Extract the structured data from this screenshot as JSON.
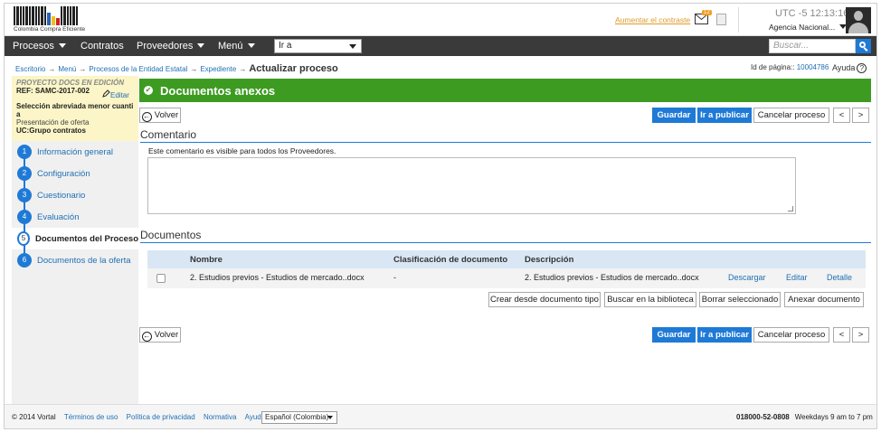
{
  "header": {
    "logo_text": "Colombia Compra Eficiente",
    "contrast_link": "Aumentar el contraste",
    "mail_badge": "12",
    "clock": "UTC -5 12:13:16",
    "agency": "Agencia Nacional..."
  },
  "nav": {
    "items": [
      "Procesos",
      "Contratos",
      "Proveedores",
      "Menú"
    ],
    "goto_value": "Ir a",
    "search_placeholder": "Buscar..."
  },
  "breadcrumb": {
    "items": [
      "Escritorio",
      "Menú",
      "Procesos de la Entidad Estatal",
      "Expediente"
    ],
    "current": "Actualizar proceso",
    "page_id_label": "Id de página::",
    "page_id": "10004786",
    "help": "Ayuda",
    "help_icon": "?"
  },
  "sidebar": {
    "status": "PROYECTO DOCS EN EDICIÓN",
    "ref": "REF: SAMC-2017-002",
    "edit": "Editar",
    "type_line1": "Selección abreviada menor cuanti",
    "type_line2": "a",
    "phase": "Presentación de oferta",
    "uc": "UC:Grupo contratos",
    "steps": [
      {
        "num": "1",
        "label": "Información general"
      },
      {
        "num": "2",
        "label": "Configuración"
      },
      {
        "num": "3",
        "label": "Cuestionario"
      },
      {
        "num": "4",
        "label": "Evaluación"
      },
      {
        "num": "5",
        "label": "Documentos del Proceso"
      },
      {
        "num": "6",
        "label": "Documentos de la oferta"
      }
    ]
  },
  "main": {
    "title": "Documentos anexos",
    "back": "Volver",
    "save": "Guardar",
    "publish": "Ir a publicar",
    "cancel": "Cancelar proceso",
    "prev": "<",
    "next": ">",
    "comment_section": "Comentario",
    "comment_note": "Este comentario es visible para todos los Proveedores.",
    "comment_value": "",
    "docs_section": "Documentos",
    "columns": [
      "Nombre",
      "Clasificación de documento",
      "Descripción"
    ],
    "rows": [
      {
        "name": "2. Estudios previos - Estudios de mercado..docx",
        "classification": "-",
        "description": "2. Estudios previos - Estudios de mercado..docx",
        "download": "Descargar",
        "edit": "Editar",
        "detail": "Detalle"
      }
    ],
    "actions": [
      "Crear desde documento tipo",
      "Buscar en la biblioteca",
      "Borrar seleccionado",
      "Anexar documento"
    ]
  },
  "footer": {
    "copyright": "© 2014 Vortal",
    "links": [
      "Términos de uso",
      "Política de privacidad",
      "Normativa",
      "Ayuda"
    ],
    "language": "Español (Colombia)",
    "phone": "018000-52-0808",
    "hours": "Weekdays 9 am to 7 pm"
  },
  "colors": {
    "accent": "#1f7ad6",
    "title_green": "#3d9b21",
    "nav_dark": "#3a3a3a",
    "project_yellow": "#fbf5c7"
  }
}
